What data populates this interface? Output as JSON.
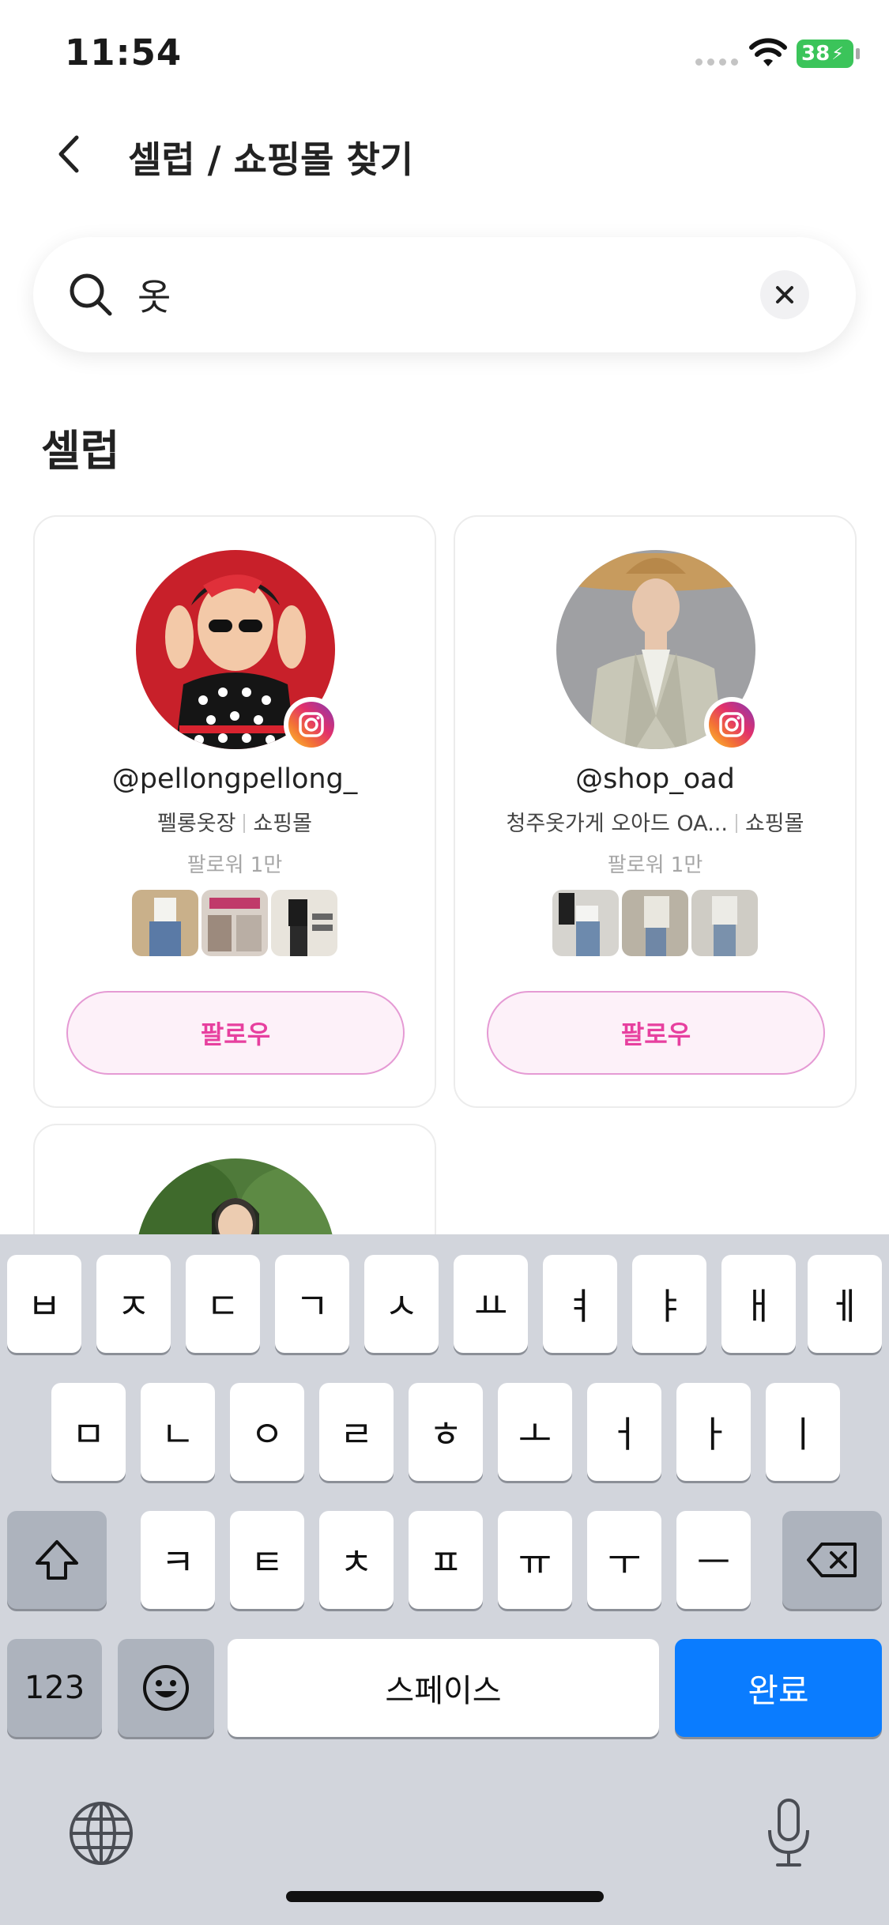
{
  "status_bar": {
    "time": "11:54",
    "battery": "38"
  },
  "header": {
    "title": "셀럽 / 쇼핑몰 찾기"
  },
  "search": {
    "value": "옷",
    "placeholder": ""
  },
  "section": {
    "title": "셀럽"
  },
  "cards": [
    {
      "handle": "@pellongpellong_",
      "name": "펠롱옷장",
      "category": "쇼핑몰",
      "followers": "팔로워 1만",
      "follow_label": "팔로우"
    },
    {
      "handle": "@shop_oad",
      "name": "청주옷가게 오아드 OA...",
      "category": "쇼핑몰",
      "followers": "팔로워 1만",
      "follow_label": "팔로우"
    }
  ],
  "keyboard": {
    "row1": [
      "ㅂ",
      "ㅈ",
      "ㄷ",
      "ㄱ",
      "ㅅ",
      "ㅛ",
      "ㅕ",
      "ㅑ",
      "ㅐ",
      "ㅔ"
    ],
    "row2": [
      "ㅁ",
      "ㄴ",
      "ㅇ",
      "ㄹ",
      "ㅎ",
      "ㅗ",
      "ㅓ",
      "ㅏ",
      "ㅣ"
    ],
    "row3": [
      "ㅋ",
      "ㅌ",
      "ㅊ",
      "ㅍ",
      "ㅠ",
      "ㅜ",
      "ㅡ"
    ],
    "numbers_label": "123",
    "space_label": "스페이스",
    "done_label": "완료"
  },
  "colors": {
    "accent_pink": "#e7409f",
    "keyboard_blue": "#0a7cff",
    "battery_green": "#3bc45a"
  }
}
